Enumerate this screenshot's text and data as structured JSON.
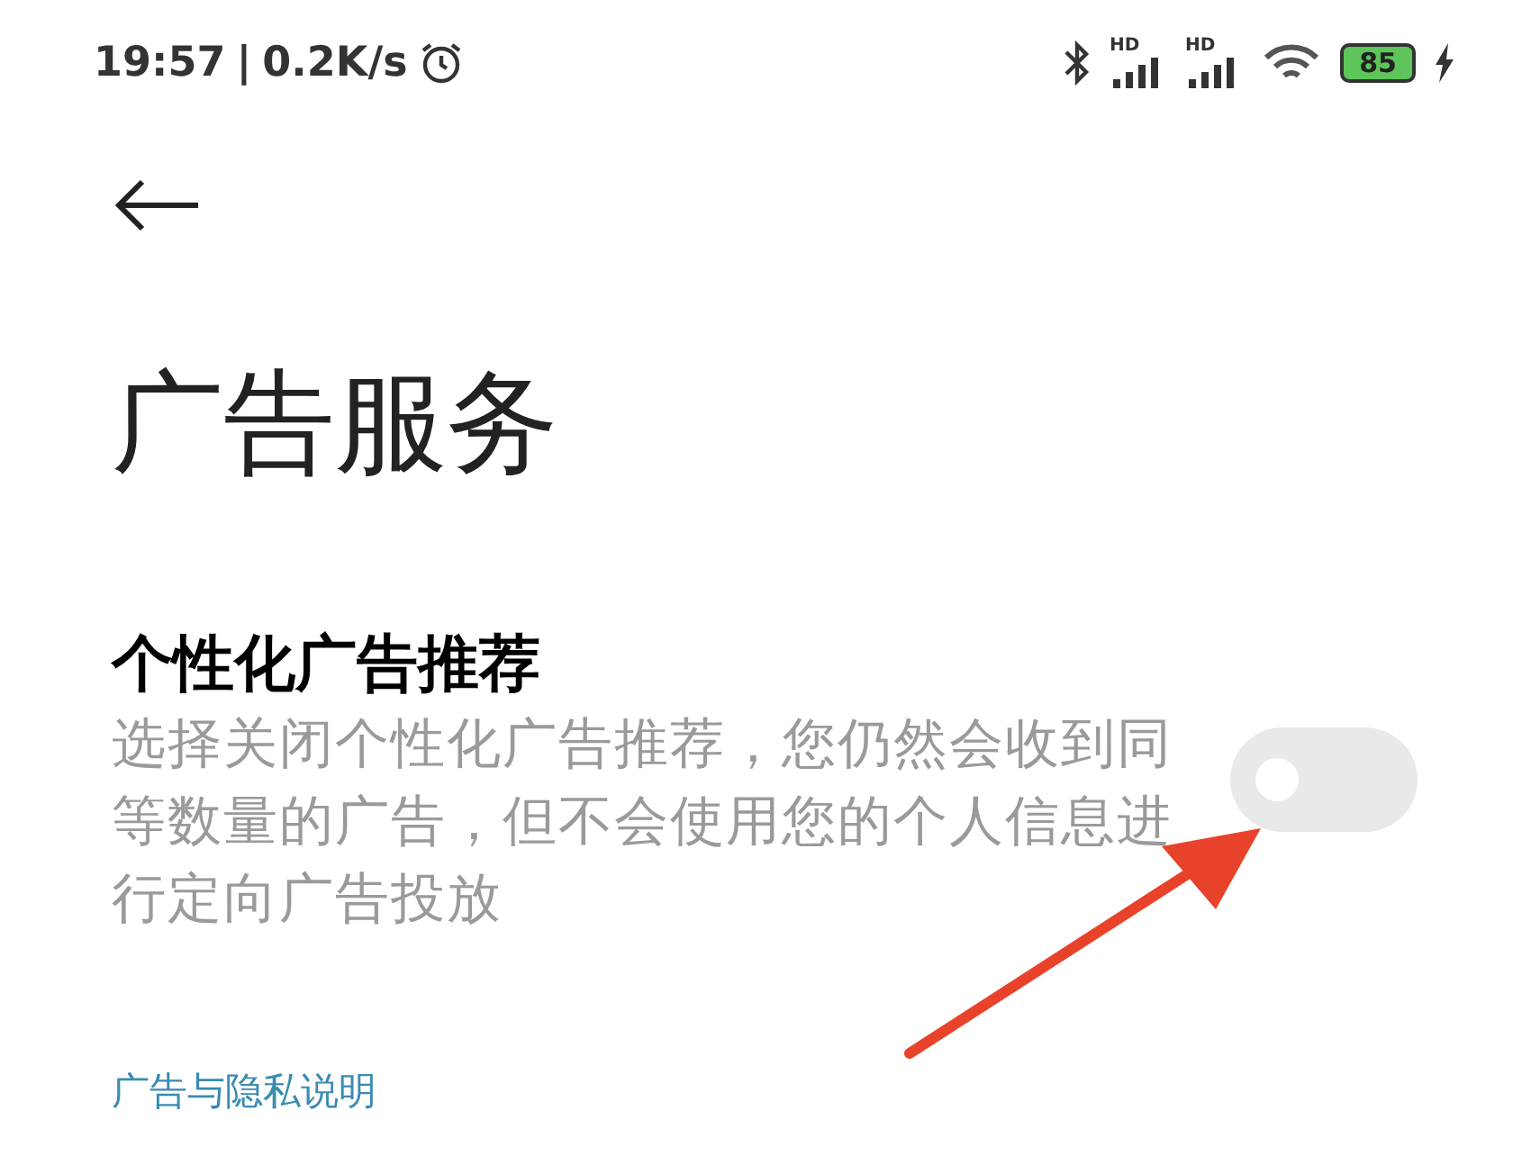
{
  "status_bar": {
    "time": "19:57",
    "speed": "0.2K/s",
    "separator": "|",
    "signal_labels": [
      "HD",
      "HD"
    ],
    "battery": "85"
  },
  "header": {
    "title": "广告服务"
  },
  "setting": {
    "title": "个性化广告推荐",
    "description": "选择关闭个性化广告推荐，您仍然会收到同等数量的广告，但不会使用您的个人信息进行定向广告投放",
    "on": false
  },
  "link": "广告与隐私说明"
}
